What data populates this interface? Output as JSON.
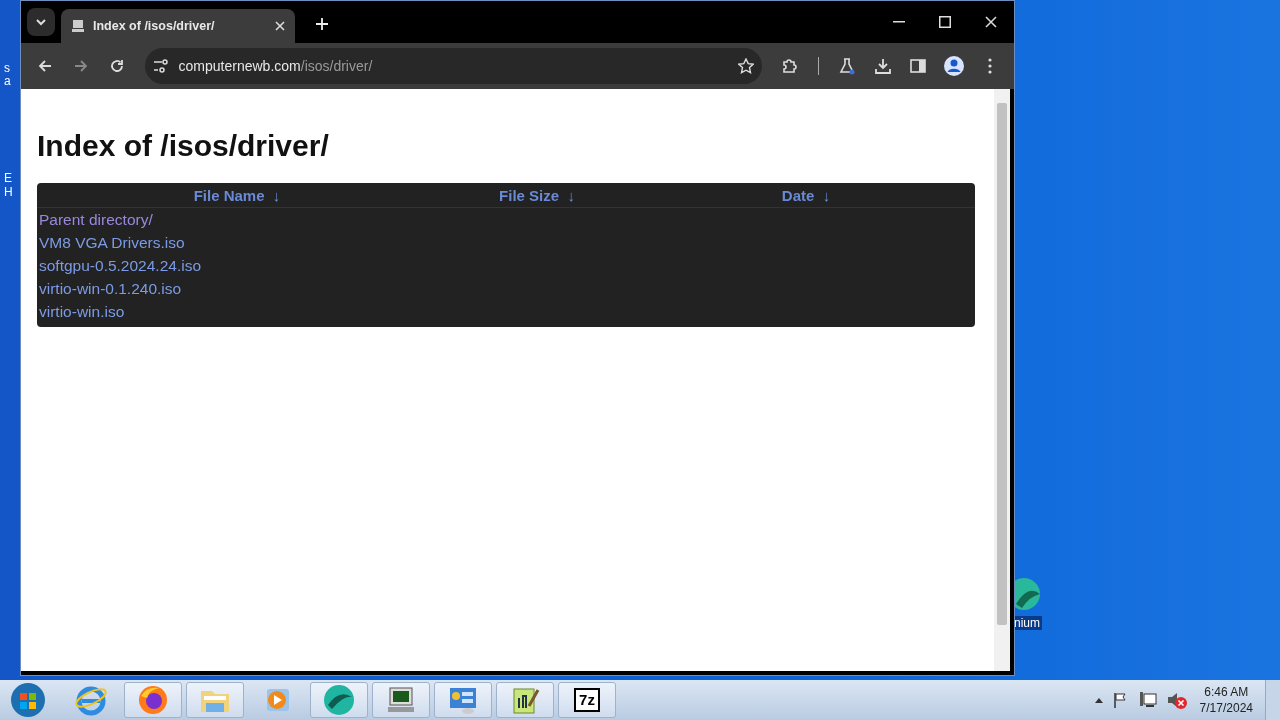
{
  "desktop": {
    "left_labels": [
      "s",
      "a",
      "E",
      "H"
    ],
    "icons": [
      {
        "label": "nium"
      }
    ]
  },
  "browser": {
    "tab": {
      "title": "Index of /isos/driver/",
      "selected": true
    },
    "address": {
      "domain": "computernewb.com",
      "path": "/isos/driver/"
    }
  },
  "page": {
    "heading": "Index of /isos/driver/",
    "columns": [
      {
        "label": "File Name",
        "arrow": "↓"
      },
      {
        "label": "File Size",
        "arrow": "↓"
      },
      {
        "label": "Date",
        "arrow": "↓"
      }
    ],
    "rows": [
      {
        "name": "Parent directory/",
        "visited": true
      },
      {
        "name": "VM8 VGA Drivers.iso",
        "visited": false
      },
      {
        "name": "softgpu-0.5.2024.24.iso",
        "visited": false
      },
      {
        "name": "virtio-win-0.1.240.iso",
        "visited": false
      },
      {
        "name": "virtio-win.iso",
        "visited": false
      }
    ]
  },
  "taskbar": {
    "apps": [
      {
        "kind": "ie"
      },
      {
        "kind": "firefox"
      },
      {
        "kind": "explorer"
      },
      {
        "kind": "media"
      },
      {
        "kind": "globe"
      },
      {
        "kind": "terminal"
      },
      {
        "kind": "control"
      },
      {
        "kind": "notepad"
      },
      {
        "kind": "archiver",
        "label": "7z"
      }
    ],
    "time": "6:46 AM",
    "date": "7/17/2024"
  }
}
